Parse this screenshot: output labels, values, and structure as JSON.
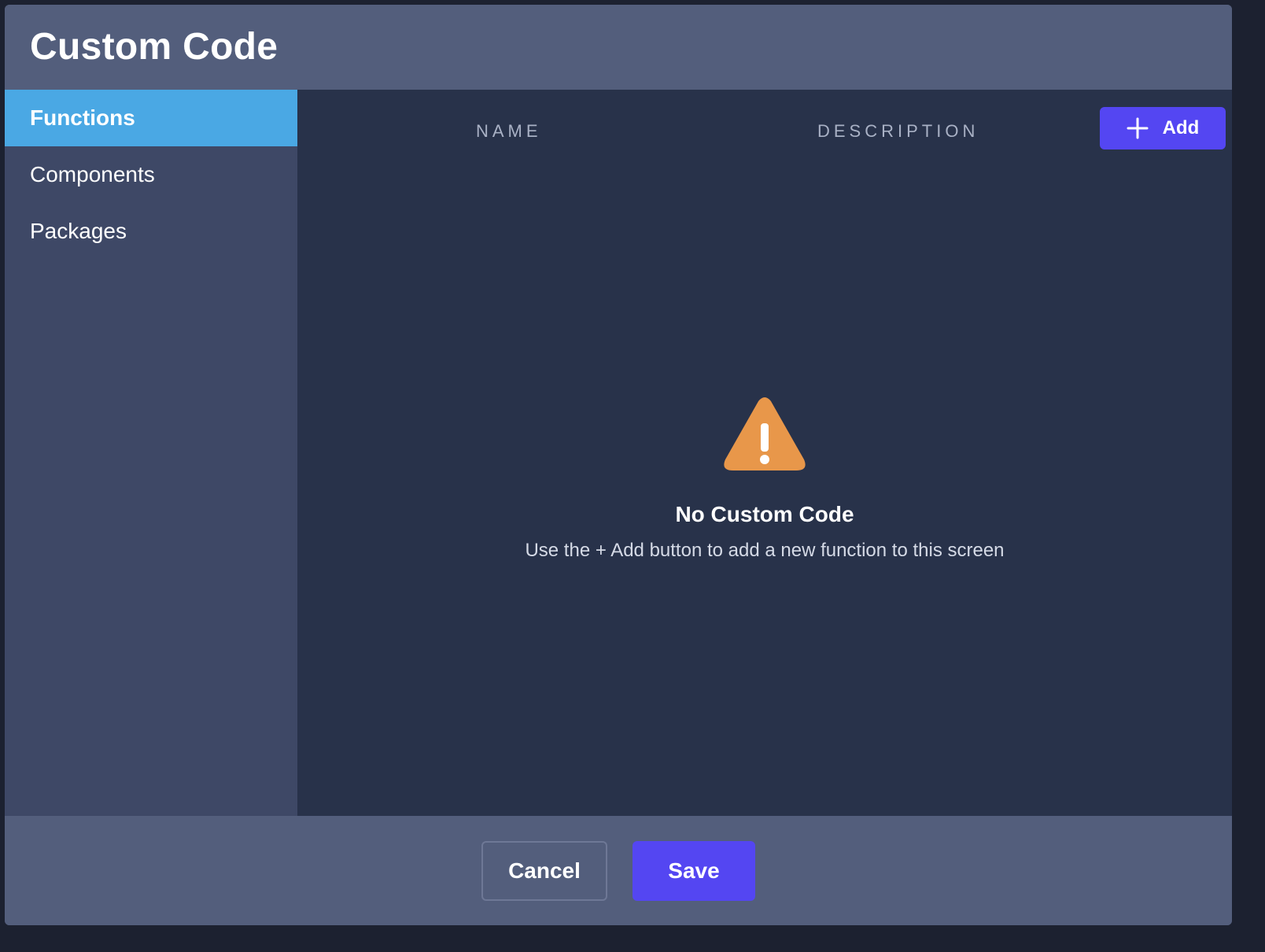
{
  "modal": {
    "title": "Custom Code"
  },
  "sidebar": {
    "items": [
      {
        "label": "Functions",
        "active": true
      },
      {
        "label": "Components",
        "active": false
      },
      {
        "label": "Packages",
        "active": false
      }
    ]
  },
  "table": {
    "columns": [
      "NAME",
      "DESCRIPTION"
    ],
    "add_button_label": "Add",
    "add_button_icon": "plus-icon"
  },
  "empty_state": {
    "icon": "warning-icon",
    "title": "No Custom Code",
    "subtitle": "Use the + Add button to add a new function to this screen"
  },
  "footer": {
    "cancel_label": "Cancel",
    "save_label": "Save"
  },
  "colors": {
    "accent": "#5446f2",
    "active_tab": "#4aa8e4",
    "warning": "#e8974a",
    "panel": "#28324a",
    "sidebar": "#3e4866",
    "header": "#535e7c"
  }
}
